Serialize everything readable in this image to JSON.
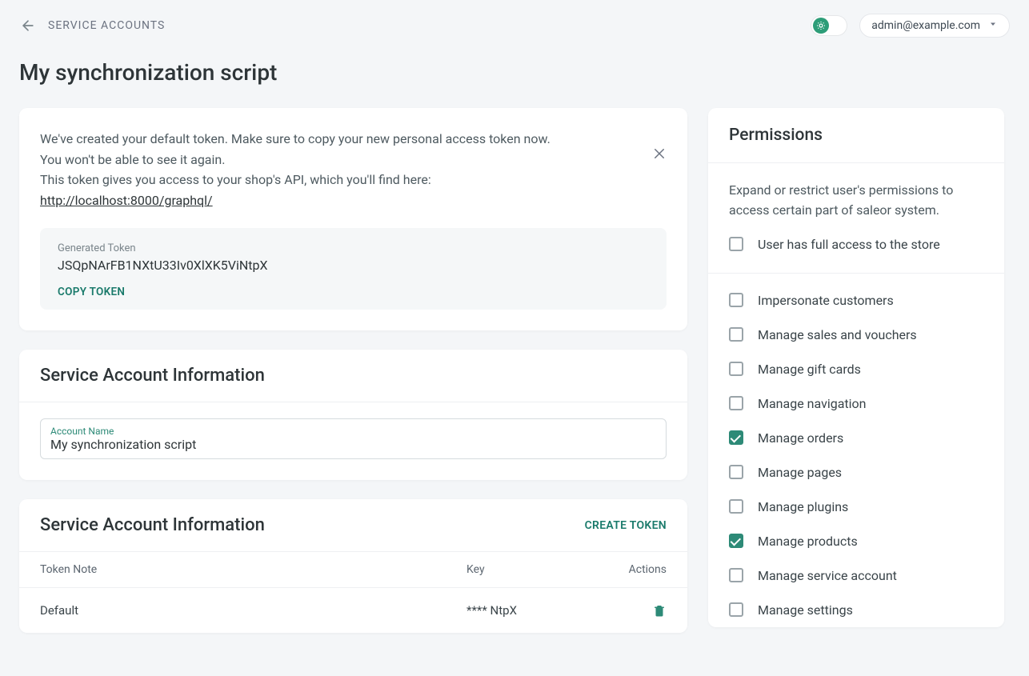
{
  "breadcrumb": "SERVICE ACCOUNTS",
  "user_email": "admin@example.com",
  "page_title": "My synchronization script",
  "token_alert": {
    "line1": "We've created your default token. Make sure to copy your new personal access token now.",
    "line2": "You won't be able to see it again.",
    "line3": "This token gives you access to your shop's API, which you'll find here:",
    "api_url": "http://localhost:8000/graphql/"
  },
  "generated_token": {
    "label": "Generated Token",
    "value": "JSQpNArFB1NXtU33Iv0XlXK5ViNtpX",
    "copy_label": "COPY TOKEN"
  },
  "account_info": {
    "heading": "Service Account Information",
    "field_label": "Account Name",
    "account_name": "My synchronization script"
  },
  "tokens_card": {
    "heading": "Service Account Information",
    "create_label": "CREATE TOKEN",
    "columns": {
      "note": "Token Note",
      "key": "Key",
      "actions": "Actions"
    },
    "rows": [
      {
        "note": "Default",
        "key": "**** NtpX"
      }
    ]
  },
  "permissions": {
    "heading": "Permissions",
    "description": "Expand or restrict user's permissions to access certain part of saleor system.",
    "full_access": {
      "label": "User has full access to the store",
      "checked": false
    },
    "items": [
      {
        "label": "Impersonate customers",
        "checked": false
      },
      {
        "label": "Manage sales and vouchers",
        "checked": false
      },
      {
        "label": "Manage gift cards",
        "checked": false
      },
      {
        "label": "Manage navigation",
        "checked": false
      },
      {
        "label": "Manage orders",
        "checked": true
      },
      {
        "label": "Manage pages",
        "checked": false
      },
      {
        "label": "Manage plugins",
        "checked": false
      },
      {
        "label": "Manage products",
        "checked": true
      },
      {
        "label": "Manage service account",
        "checked": false
      },
      {
        "label": "Manage settings",
        "checked": false
      }
    ]
  }
}
